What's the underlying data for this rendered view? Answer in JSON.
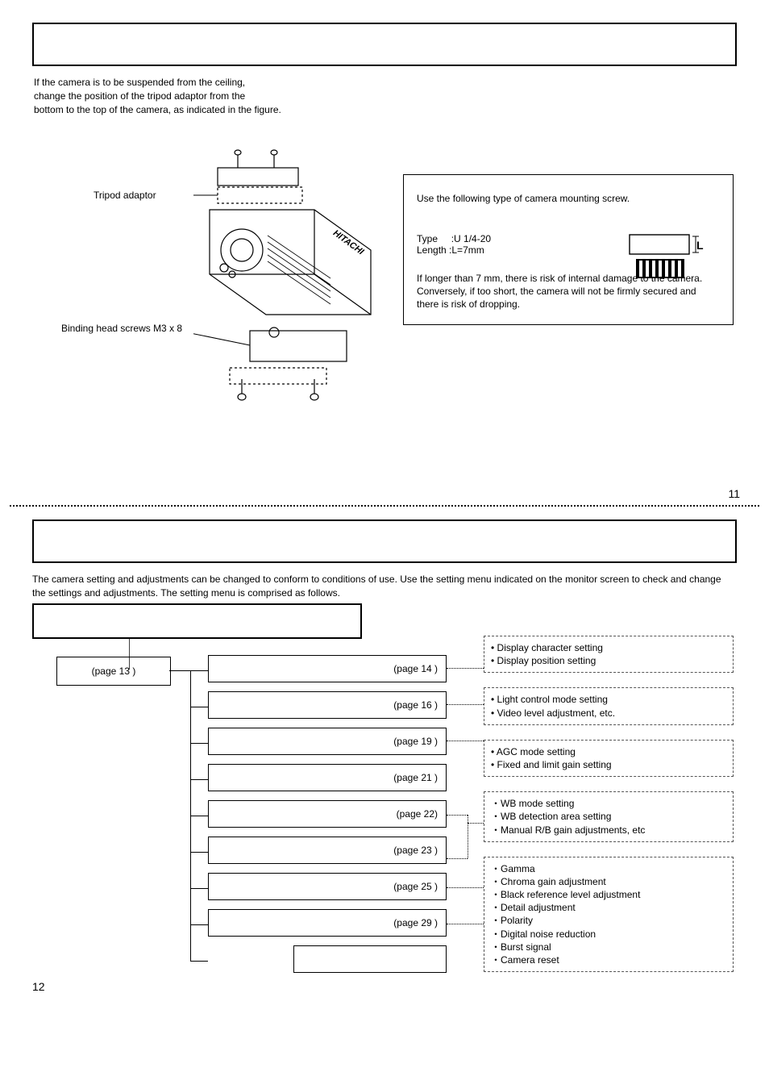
{
  "page11": {
    "intro": "If the camera is to be suspended from the ceiling, change the position of the tripod adaptor from the bottom to the top of the camera, as indicated in the figure.",
    "label_tripod": "Tripod adaptor",
    "label_screws": "Binding head screws M3 x 8",
    "mount": {
      "pre": "Use the following type of camera mounting screw.",
      "type_label": "Type",
      "type_value": ":U 1/4-20",
      "length_label": "Length",
      "length_value": ":L=7mm",
      "post": "If longer than 7 mm, there is risk of internal damage to the camera. Conversely, if too short, the camera will not be firmly secured and there is risk of dropping."
    },
    "page_num": "11"
  },
  "page12": {
    "desc": "The camera setting and adjustments can be changed to conform to conditions of use. Use the setting menu indicated on the monitor screen to check and change the settings and adjustments. The setting menu is comprised as follows.",
    "main_menu_page": "(page 13 )",
    "subs": [
      "(page 14 )",
      "(page 16 )",
      "(page 19 )",
      "(page 21 )",
      "(page 22)",
      "(page 23 )",
      "(page 25 )",
      "(page 29 )",
      ""
    ],
    "side": {
      "b0": [
        "• Display character setting",
        "• Display position setting"
      ],
      "b1": [
        "• Light control mode setting",
        "• Video level adjustment, etc."
      ],
      "b2": [
        "• AGC mode setting",
        "• Fixed and limit gain setting"
      ],
      "b3": [
        "・WB mode setting",
        "・WB detection area setting",
        "・Manual R/B gain adjustments, etc"
      ],
      "b4": [
        "・Gamma",
        "・Chroma gain adjustment",
        "・Black reference level adjustment",
        "・Detail adjustment",
        "・Polarity",
        "・Digital noise reduction",
        "・Burst signal",
        "・Camera reset"
      ]
    },
    "page_num": "12"
  }
}
